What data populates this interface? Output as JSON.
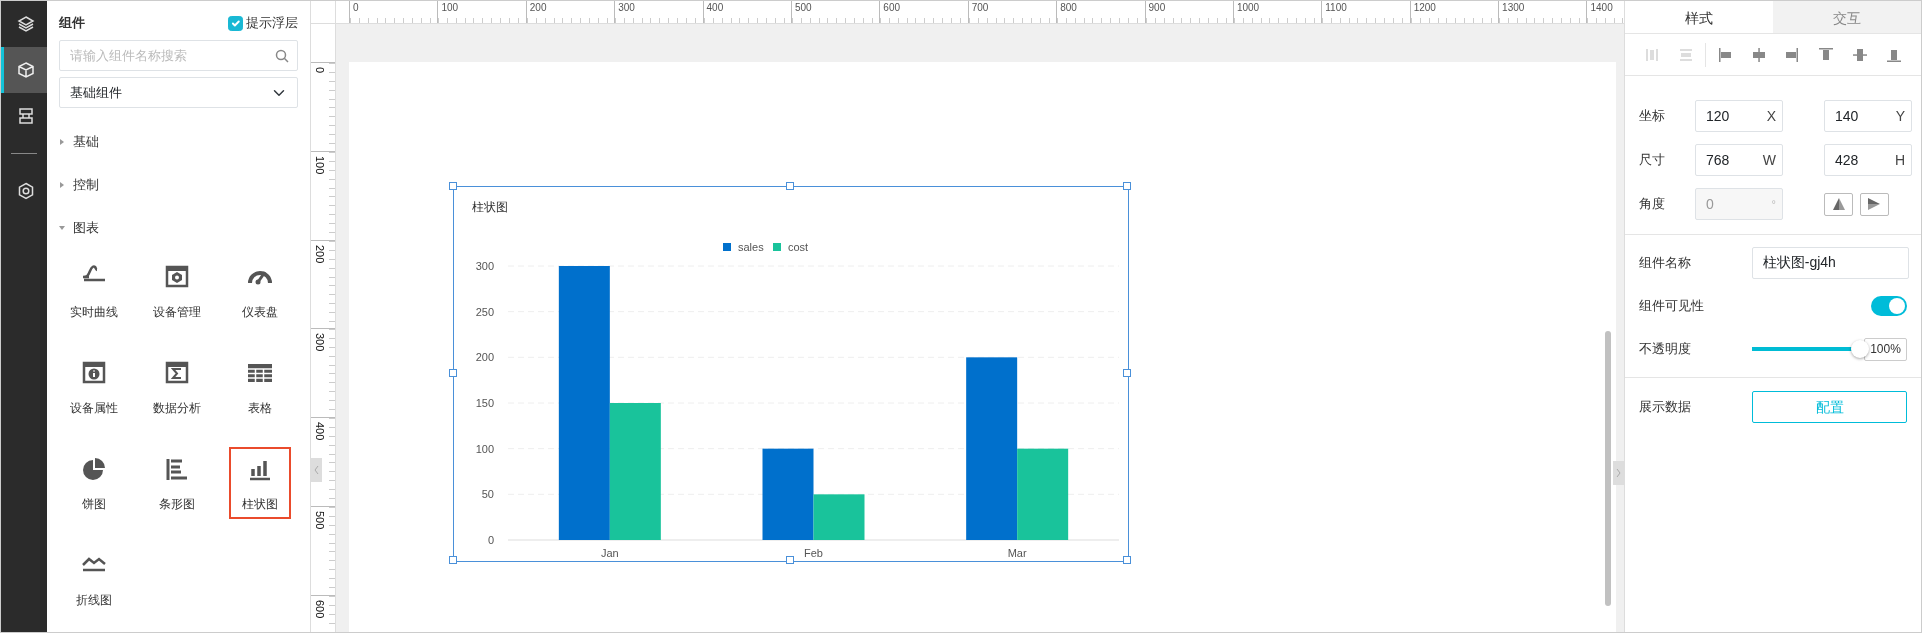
{
  "rail_top": [
    {
      "kind": "layers",
      "selected": false
    },
    {
      "kind": "cube",
      "selected": true
    },
    {
      "kind": "layout",
      "selected": false
    }
  ],
  "rail_bottom": [
    {
      "kind": "gear",
      "selected": false
    }
  ],
  "panel": {
    "title": "组件",
    "overlay_hint": {
      "label": "提示浮层",
      "checked": true
    },
    "search": {
      "placeholder": "请输入组件名称搜索"
    },
    "category": {
      "value": "基础组件"
    },
    "groups": [
      {
        "label": "基础",
        "expanded": false
      },
      {
        "label": "控制",
        "expanded": false
      },
      {
        "label": "图表",
        "expanded": true,
        "items": [
          {
            "kind": "curve",
            "label": "实时曲线",
            "selected": false
          },
          {
            "kind": "device",
            "label": "设备管理",
            "selected": false
          },
          {
            "kind": "gauge",
            "label": "仪表盘",
            "selected": false
          },
          {
            "kind": "info",
            "label": "设备属性",
            "selected": false
          },
          {
            "kind": "sigma",
            "label": "数据分析",
            "selected": false
          },
          {
            "kind": "table",
            "label": "表格",
            "selected": false
          },
          {
            "kind": "pie",
            "label": "饼图",
            "selected": false
          },
          {
            "kind": "hbar",
            "label": "条形图",
            "selected": false
          },
          {
            "kind": "column",
            "label": "柱状图",
            "selected": true
          },
          {
            "kind": "line",
            "label": "折线图",
            "selected": false
          }
        ]
      }
    ]
  },
  "canvas": {
    "h_ruler": [
      "0",
      "100",
      "200",
      "300",
      "400",
      "500",
      "600",
      "700",
      "800",
      "900",
      "1000",
      "1100",
      "1200",
      "1300",
      "1400"
    ],
    "v_ruler": [
      "0",
      "100",
      "200",
      "300",
      "400",
      "500",
      "600"
    ],
    "widget": {
      "selected": true,
      "chart_data": {
        "type": "bar",
        "title": "柱状图",
        "categories": [
          "Jan",
          "Feb",
          "Mar"
        ],
        "series": [
          {
            "name": "sales",
            "color": "#0070cc",
            "values": [
              300,
              100,
              200
            ]
          },
          {
            "name": "cost",
            "color": "#19c39b",
            "values": [
              150,
              50,
              100
            ]
          }
        ],
        "ylim": [
          0,
          300
        ],
        "yticks": [
          {
            "value": 0,
            "label": "0"
          },
          {
            "value": 50,
            "label": "50"
          },
          {
            "value": 100,
            "label": "100"
          },
          {
            "value": 150,
            "label": "150"
          },
          {
            "value": 200,
            "label": "200"
          },
          {
            "value": 250,
            "label": "250"
          },
          {
            "value": 300,
            "label": "300"
          }
        ],
        "grid": true,
        "legend": true
      }
    }
  },
  "inspector": {
    "tabs": [
      {
        "label": "样式",
        "selected": true
      },
      {
        "label": "交互",
        "selected": false
      }
    ],
    "align": [
      {
        "kind": "dist-h",
        "disabled": true
      },
      {
        "kind": "dist-v",
        "disabled": true
      },
      {
        "kind": "left",
        "disabled": false
      },
      {
        "kind": "center-h",
        "disabled": false
      },
      {
        "kind": "right",
        "disabled": false
      },
      {
        "kind": "top",
        "disabled": false
      },
      {
        "kind": "middle",
        "disabled": false
      },
      {
        "kind": "bottom",
        "disabled": false
      }
    ],
    "position": {
      "label": "坐标",
      "fields": [
        {
          "value": "120",
          "unit": "X"
        },
        {
          "value": "140",
          "unit": "Y"
        }
      ]
    },
    "size": {
      "label": "尺寸",
      "fields": [
        {
          "value": "768",
          "unit": "W"
        },
        {
          "value": "428",
          "unit": "H"
        }
      ]
    },
    "angle": {
      "label": "角度",
      "value": "0",
      "unit": "°",
      "disabled": true,
      "flips": [
        {
          "kind": "flip-v"
        },
        {
          "kind": "flip-h"
        }
      ]
    },
    "name": {
      "label": "组件名称",
      "value": "柱状图-gj4h"
    },
    "visible": {
      "label": "组件可见性",
      "on": true
    },
    "opacity": {
      "label": "不透明度",
      "level": 1,
      "reading": "100%"
    },
    "data": {
      "label": "展示数据",
      "button": "配置"
    }
  }
}
